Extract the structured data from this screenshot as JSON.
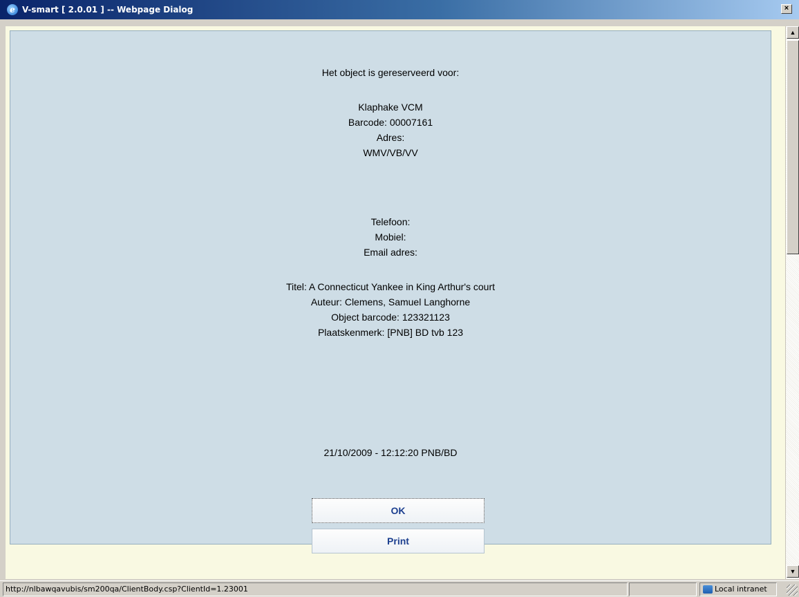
{
  "window": {
    "title": "V-smart [ 2.0.01 ] -- Webpage Dialog",
    "close_label": "×"
  },
  "reservation": {
    "heading": "Het object is gereserveerd voor:",
    "name": "Klaphake VCM",
    "barcode": "Barcode: 00007161",
    "address_label": "Adres:",
    "address_value": "WMV/VB/VV",
    "telephone": "Telefoon:",
    "mobile": "Mobiel:",
    "email": "Email adres:",
    "title": "Titel: A Connecticut Yankee in King Arthur's court",
    "author": "Auteur: Clemens, Samuel Langhorne",
    "object_barcode": "Object barcode: 123321123",
    "shelfmark": "Plaatskenmerk: [PNB] BD tvb 123",
    "timestamp": "21/10/2009 - 12:12:20 PNB/BD"
  },
  "buttons": {
    "ok": "OK",
    "print": "Print"
  },
  "statusbar": {
    "url": "http://nlbawqavubis/sm200qa/ClientBody.csp?ClientId=1.23001",
    "zone": "Local intranet"
  },
  "icons": [
    "ie-icon",
    "close-icon",
    "scroll-up-icon",
    "scroll-down-icon",
    "intranet-zone-icon"
  ]
}
